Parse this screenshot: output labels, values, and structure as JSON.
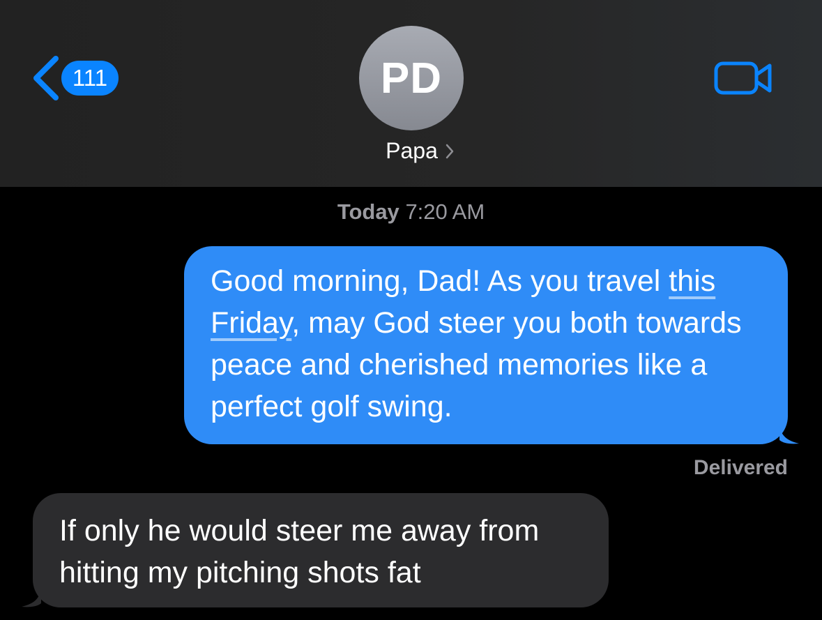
{
  "header": {
    "back_count": "111",
    "avatar_initials": "PD",
    "contact_name": "Papa",
    "icons": {
      "back": "chevron-left-icon",
      "contact_detail": "chevron-right-icon",
      "video": "video-camera-icon"
    }
  },
  "conversation": {
    "timestamp_day": "Today",
    "timestamp_time": "7:20 AM",
    "outgoing": {
      "part1": "Good morning, Dad! As you travel ",
      "date_link": "this Friday",
      "part2": ", may God steer you both towards peace and cherished memories like a perfect golf swing."
    },
    "status": "Delivered",
    "incoming": {
      "text": "If only he would steer me away from hitting my pitching shots fat"
    }
  },
  "colors": {
    "accent": "#0a84ff",
    "outgoing_bubble": "#2f8cf7",
    "incoming_bubble": "#2c2c2e",
    "background": "#000000",
    "header": "#252525",
    "secondary_text": "#9a9aa0"
  }
}
